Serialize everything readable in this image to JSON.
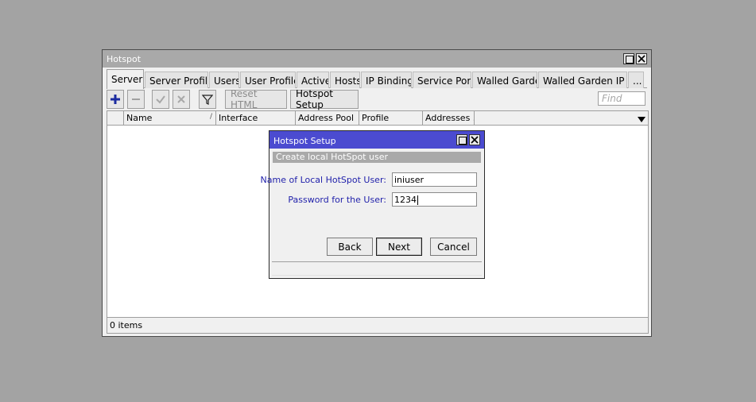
{
  "window": {
    "title": "Hotspot",
    "tabs": [
      "Servers",
      "Server Profiles",
      "Users",
      "User Profiles",
      "Active",
      "Hosts",
      "IP Bindings",
      "Service Ports",
      "Walled Garden",
      "Walled Garden IP List",
      "..."
    ],
    "active_tab": "Servers",
    "toolbar": {
      "add_icon": "plus-icon",
      "remove_icon": "minus-icon",
      "enable_icon": "check-icon",
      "disable_icon": "x-icon",
      "filter_icon": "funnel-icon",
      "reset_html_label": "Reset HTML",
      "hotspot_setup_label": "Hotspot Setup",
      "find_placeholder": "Find"
    },
    "columns": [
      "Name",
      "Interface",
      "Address Pool",
      "Profile",
      "Addresses ..."
    ],
    "status": "0 items"
  },
  "dialog": {
    "title": "Hotspot Setup",
    "section": "Create local HotSpot user",
    "fields": [
      {
        "label": "Name of Local HotSpot User:",
        "value": "iniuser"
      },
      {
        "label": "Password for the User:",
        "value": "1234"
      }
    ],
    "buttons": {
      "back": "Back",
      "next": "Next",
      "cancel": "Cancel"
    }
  },
  "colors": {
    "desktop": "#a3a3a3",
    "dialog_title": "#4b4bd0",
    "label_text": "#1f1faa",
    "add_icon": "#1c2ba0"
  }
}
